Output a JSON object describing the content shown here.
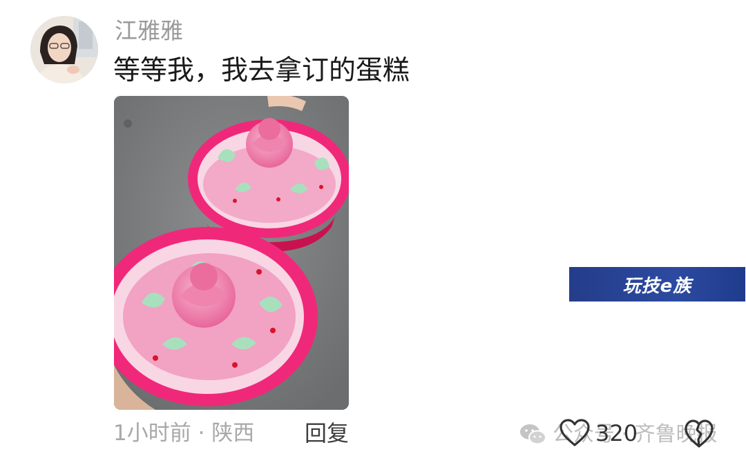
{
  "comment": {
    "username": "江雅雅",
    "text": "等等我，我去拿订的蛋糕",
    "avatar_icon": "user-avatar-photo",
    "photo_icon": "rose-cupcakes-photo",
    "time_location": "1小时前 · 陕西",
    "reply_label": "回复",
    "like_count": "320",
    "like_icon": "heart-outline-icon",
    "dislike_icon": "broken-heart-outline-icon"
  },
  "watermarks": {
    "badge_text": "玩技e族",
    "account_text": "公众号 · 齐鲁晚报",
    "wechat_icon": "wechat-icon",
    "badge_color": "#2a4597"
  }
}
